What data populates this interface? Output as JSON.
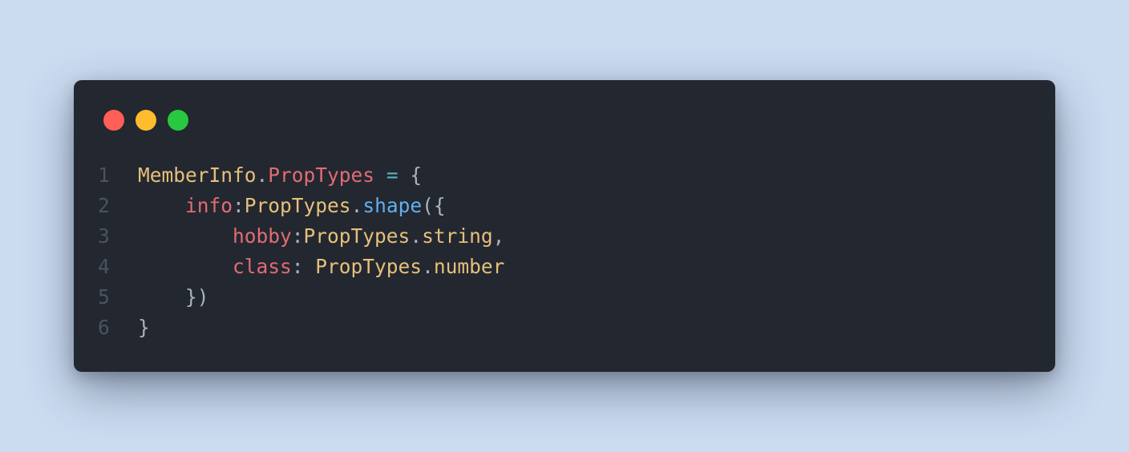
{
  "colors": {
    "background": "#cbdcf1",
    "window": "#23272f",
    "close_dot": "#ff5f57",
    "minimize_dot": "#febc2e",
    "maximize_dot": "#28c840",
    "line_number": "#4b5263",
    "identifier": "#e5c07b",
    "property": "#e06c75",
    "function": "#61afef",
    "operator": "#56b6c2",
    "punctuation": "#abb2bf"
  },
  "window_controls": [
    "close",
    "minimize",
    "maximize"
  ],
  "code": {
    "lines": [
      {
        "number": "1",
        "tokens": [
          {
            "text": "MemberInfo",
            "kind": "identifier"
          },
          {
            "text": ".",
            "kind": "punctuation"
          },
          {
            "text": "PropTypes",
            "kind": "property"
          },
          {
            "text": " ",
            "kind": "punctuation"
          },
          {
            "text": "=",
            "kind": "operator"
          },
          {
            "text": " {",
            "kind": "punctuation"
          }
        ]
      },
      {
        "number": "2",
        "tokens": [
          {
            "text": "    ",
            "kind": "punctuation"
          },
          {
            "text": "info",
            "kind": "property"
          },
          {
            "text": ":",
            "kind": "punctuation"
          },
          {
            "text": "PropTypes",
            "kind": "identifier"
          },
          {
            "text": ".",
            "kind": "punctuation"
          },
          {
            "text": "shape",
            "kind": "function"
          },
          {
            "text": "({",
            "kind": "punctuation"
          }
        ]
      },
      {
        "number": "3",
        "tokens": [
          {
            "text": "        ",
            "kind": "punctuation"
          },
          {
            "text": "hobby",
            "kind": "property"
          },
          {
            "text": ":",
            "kind": "punctuation"
          },
          {
            "text": "PropTypes",
            "kind": "identifier"
          },
          {
            "text": ".",
            "kind": "punctuation"
          },
          {
            "text": "string",
            "kind": "identifier"
          },
          {
            "text": ",",
            "kind": "punctuation"
          }
        ]
      },
      {
        "number": "4",
        "tokens": [
          {
            "text": "        ",
            "kind": "punctuation"
          },
          {
            "text": "class",
            "kind": "property"
          },
          {
            "text": ": ",
            "kind": "punctuation"
          },
          {
            "text": "PropTypes",
            "kind": "identifier"
          },
          {
            "text": ".",
            "kind": "punctuation"
          },
          {
            "text": "number",
            "kind": "identifier"
          }
        ]
      },
      {
        "number": "5",
        "tokens": [
          {
            "text": "    ",
            "kind": "punctuation"
          },
          {
            "text": "})",
            "kind": "punctuation"
          }
        ]
      },
      {
        "number": "6",
        "tokens": [
          {
            "text": "}",
            "kind": "punctuation"
          }
        ]
      }
    ]
  }
}
